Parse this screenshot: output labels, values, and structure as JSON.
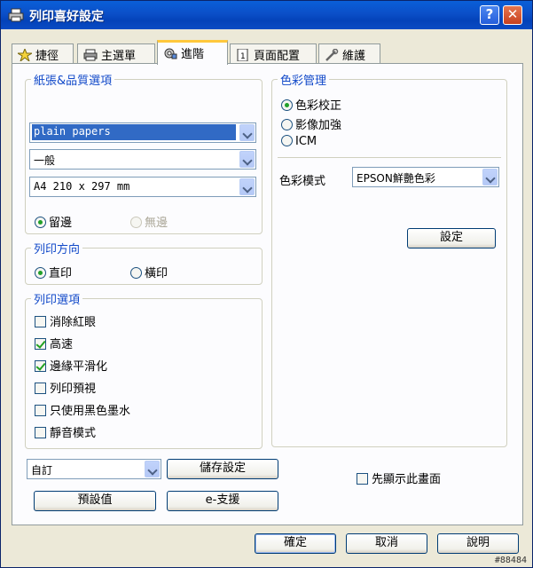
{
  "window": {
    "title": "列印喜好設定"
  },
  "tabs": [
    {
      "label": "捷徑",
      "icon": "star-icon"
    },
    {
      "label": "主選單",
      "icon": "printer-icon"
    },
    {
      "label": "進階",
      "icon": "gear-icon",
      "active": true
    },
    {
      "label": "頁面配置",
      "icon": "page-icon"
    },
    {
      "label": "維護",
      "icon": "wrench-icon"
    }
  ],
  "paper_quality": {
    "title": "紙張&品質選項",
    "media_type": "plain papers",
    "quality": "一般",
    "paper_size": "A4 210 x 297 mm",
    "margin_label": "留邊",
    "borderless_label": "無邊"
  },
  "orientation": {
    "title": "列印方向",
    "portrait": "直印",
    "landscape": "橫印"
  },
  "print_options": {
    "title": "列印選項",
    "items": [
      {
        "label": "消除紅眼",
        "checked": false
      },
      {
        "label": "高速",
        "checked": true
      },
      {
        "label": "邊緣平滑化",
        "checked": true
      },
      {
        "label": "列印預視",
        "checked": false
      },
      {
        "label": "只使用黑色墨水",
        "checked": false
      },
      {
        "label": "靜音模式",
        "checked": false
      }
    ]
  },
  "color_management": {
    "title": "色彩管理",
    "options": [
      "色彩校正",
      "影像加強",
      "ICM"
    ],
    "mode_label": "色彩模式",
    "mode_value": "EPSON鮮艷色彩",
    "settings_button": "設定"
  },
  "bottom": {
    "custom_select": "自訂",
    "save_button": "儲存設定",
    "defaults_button": "預設值",
    "support_button": "e-支援",
    "show_first_label": "先顯示此畫面"
  },
  "footer": {
    "ok": "確定",
    "cancel": "取消",
    "help": "說明"
  },
  "watermark": "#88484",
  "colors": {
    "title_bar": "#0b4fc8",
    "group_title": "#1149c9",
    "selection": "#316ac5"
  }
}
